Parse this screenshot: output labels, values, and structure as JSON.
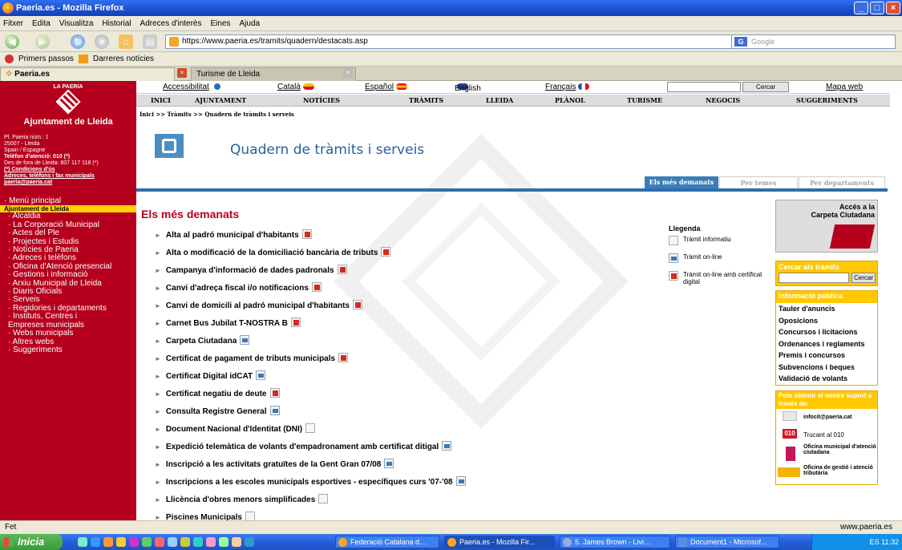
{
  "window": {
    "title": "Paeria.es - Mozilla Firefox"
  },
  "menubar": [
    "Fitxer",
    "Edita",
    "Visualitza",
    "Historial",
    "Adreces d'interès",
    "Eines",
    "Ajuda"
  ],
  "url": "https://www.paeria.es/tramits/quadern/destacats.asp",
  "search_placeholder": "Google",
  "bookmarks": [
    "Primers passos",
    "Darreres notícies"
  ],
  "tabs": [
    "Paeria.es",
    "Turisme de Lleida"
  ],
  "sidebar": {
    "logo_text": "LA PAERIA",
    "name": "Ajuntament de Lleida",
    "addr": [
      "Pl. Paeria núm.: 1",
      "25007 - Lleida",
      "Spain / Espagne"
    ],
    "phone": "Telèfon d'atenció: 010 (*)",
    "phone2": "Des de fora de Lleida: 807 117 118 (*)",
    "conditions": "(*) Condicions d'ús",
    "links": [
      "Adreces, telèfons i fax municipals",
      "paeria@paeria.cat"
    ],
    "menu_main": "· Menú principal",
    "section": "Ajuntament de Lleida",
    "items": [
      "· Alcaldia",
      "· La Corporació Municipal",
      "· Actes del Ple",
      "· Projectes i Estudis",
      "· Notícies de Paeria",
      "· Adreces i telèfons",
      "· Oficina d'Atenció presencial",
      "· Gestions i informació",
      "· Arxiu Municipal de Lleida",
      "· Diaris Oficials",
      "· Serveis",
      "· Regidories i departaments",
      "· Instituts, Centres i",
      "Empreses municipals",
      "· Webs municipals",
      "· Altres webs",
      "· Suggeriments"
    ]
  },
  "toplinks": {
    "access": "Accessibilitat",
    "ca": "Català",
    "es": "Español",
    "en": "English",
    "fr": "Français",
    "search_btn": "Cercar",
    "map": "Mapa web"
  },
  "mainnav": [
    "INICI",
    "AJUNTAMENT",
    "NOTÍCIES",
    "TRÀMITS",
    "LLEIDA",
    "PLÀNOL",
    "TURISME",
    "NEGOCIS",
    "SUGGERIMENTS"
  ],
  "breadcrumb": "Inici >> Tràmits >> Quadern de tràmits i serveis",
  "page_title": "Quadern de tràmits i serveis",
  "content_tabs": [
    "Els més demanats",
    "Per temes",
    "Per departaments"
  ],
  "section_title": "Els més demanats",
  "items": [
    {
      "label": "Alta al padró municipal d'habitants",
      "icon": "red"
    },
    {
      "label": "Alta o modificació de la domiciliació bancària de tributs",
      "icon": "red"
    },
    {
      "label": "Campanya d'informació de dades padronals",
      "icon": "red"
    },
    {
      "label": "Canvi d'adreça fiscal i/o notificacions",
      "icon": "red"
    },
    {
      "label": "Canvi de domicili al padró municipal d'habitants",
      "icon": "red"
    },
    {
      "label": "Carnet Bus Jubilat T-NOSTRA B",
      "icon": "red"
    },
    {
      "label": "Carpeta Ciutadana",
      "icon": "blue"
    },
    {
      "label": "Certificat de pagament de tributs municipals",
      "icon": "red"
    },
    {
      "label": "Certificat Digital idCAT",
      "icon": "blue"
    },
    {
      "label": "Certificat negatiu de deute",
      "icon": "red"
    },
    {
      "label": "Consulta Registre General",
      "icon": "blue"
    },
    {
      "label": "Document Nacional d'Identitat (DNI)",
      "icon": "grey"
    },
    {
      "label": "Expedició telemàtica de volants d'empadronament amb certificat ditigal",
      "icon": "blue"
    },
    {
      "label": "Inscripció a les activitats gratuïtes de la Gent Gran 07/08",
      "icon": "blue"
    },
    {
      "label": "Inscripcions a les escoles municipals esportives - específiques curs '07-'08",
      "icon": "blue"
    },
    {
      "label": "Llicència d'obres menors simplificades",
      "icon": "grey"
    },
    {
      "label": "Piscines Municipals",
      "icon": "grey"
    }
  ],
  "legend": {
    "title": "Llegenda",
    "rows": [
      "Tràmit informatiu",
      "Tràmit on-line",
      "Tràmit on-line amb certificat digital"
    ]
  },
  "carpeta": [
    "Accés a la",
    "Carpeta Ciutadana"
  ],
  "cercar": {
    "title": "Cercar als tràmits",
    "btn": "Cercar"
  },
  "info": {
    "title": "Informació pública",
    "links": [
      "Tauler d'anuncis",
      "Oposicions",
      "Concursos i licitacions",
      "Ordenances i reglaments",
      "Premis i concursos",
      "Subvencions i beques",
      "Validació de volants"
    ]
  },
  "support": {
    "title": "Pots obtenir el nostre suport a través de:",
    "rows": [
      "infocit@paeria.cat",
      "Trucant al 010",
      "Oficina municipal d'atenció ciutadana",
      "Oficina de gestió i atenció tributària"
    ],
    "badge": "010"
  },
  "status": {
    "left": "Fet",
    "right": "www.paeria.es"
  },
  "taskbar": {
    "start": "Inicia",
    "items": [
      "Federació Catalana d...",
      "Paeria.es - Mozilla Fir...",
      "5. James Brown - Livi...",
      "Document1 - Microsof..."
    ],
    "tray": "ES 11:32"
  }
}
